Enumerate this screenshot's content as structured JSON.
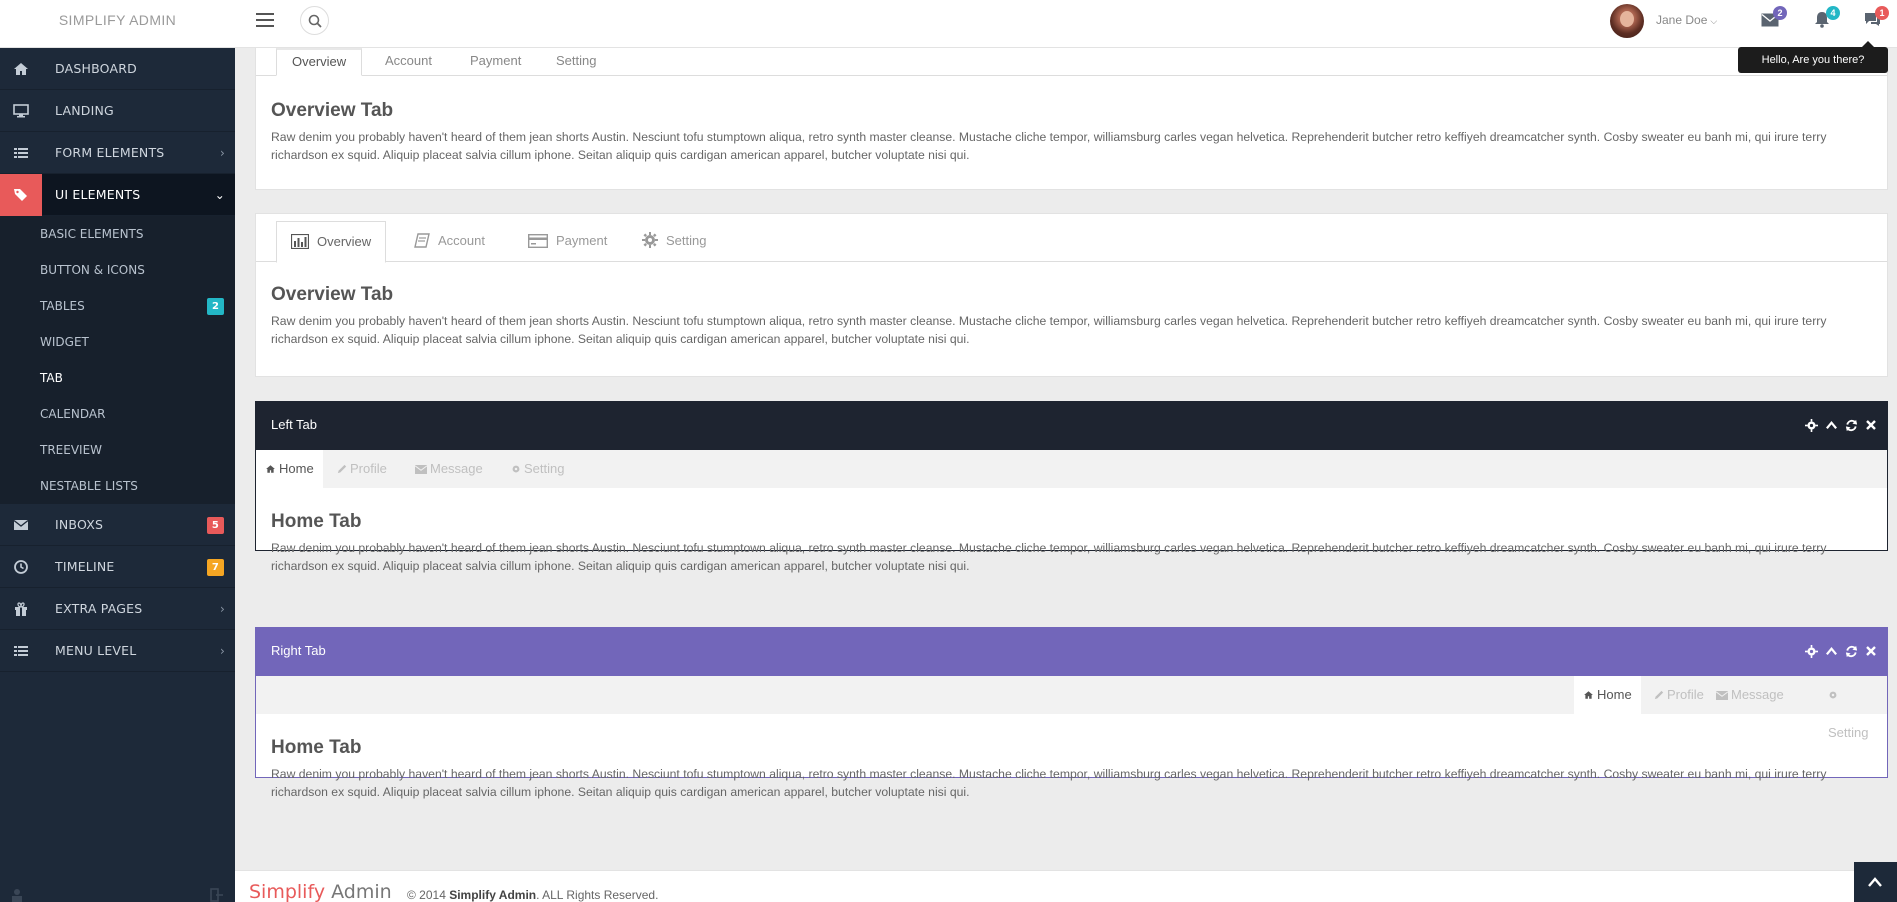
{
  "brand": "SIMPLIFY ADMIN",
  "user": {
    "name": "Jane Doe"
  },
  "notifications": {
    "mail_count": "2",
    "bell_count": "4",
    "chat_count": "1"
  },
  "tooltip": "Hello, Are you there?",
  "sidebar": {
    "items": [
      {
        "label": "DASHBOARD",
        "icon": "home-icon"
      },
      {
        "label": "LANDING",
        "icon": "monitor-icon"
      },
      {
        "label": "FORM ELEMENTS",
        "icon": "list-icon"
      },
      {
        "label": "UI ELEMENTS",
        "icon": "tags-icon"
      }
    ],
    "sub_items": [
      {
        "label": "BASIC ELEMENTS"
      },
      {
        "label": "BUTTON & ICONS"
      },
      {
        "label": "TABLES",
        "badge": "2"
      },
      {
        "label": "WIDGET"
      },
      {
        "label": "TAB"
      },
      {
        "label": "CALENDAR"
      },
      {
        "label": "TREEVIEW"
      },
      {
        "label": "NESTABLE LISTS"
      }
    ],
    "items2": [
      {
        "label": "INBOXS",
        "icon": "envelope-icon",
        "badge": "5"
      },
      {
        "label": "TIMELINE",
        "icon": "clock-icon",
        "badge": "7"
      },
      {
        "label": "EXTRA PAGES",
        "icon": "gift-icon"
      },
      {
        "label": "MENU LEVEL",
        "icon": "list-icon"
      }
    ]
  },
  "panel1": {
    "tabs": [
      "Overview",
      "Account",
      "Payment",
      "Setting"
    ],
    "title": "Overview Tab",
    "text": "Raw denim you probably haven't heard of them jean shorts Austin. Nesciunt tofu stumptown aliqua, retro synth master cleanse. Mustache cliche tempor, williamsburg carles vegan helvetica. Reprehenderit butcher retro keffiyeh dreamcatcher synth. Cosby sweater eu banh mi, qui irure terry richardson ex squid. Aliquip placeat salvia cillum iphone. Seitan aliquip quis cardigan american apparel, butcher voluptate nisi qui."
  },
  "panel2": {
    "tabs": [
      "Overview",
      "Account",
      "Payment",
      "Setting"
    ],
    "title": "Overview Tab",
    "text": "Raw denim you probably haven't heard of them jean shorts Austin. Nesciunt tofu stumptown aliqua, retro synth master cleanse. Mustache cliche tempor, williamsburg carles vegan helvetica. Reprehenderit butcher retro keffiyeh dreamcatcher synth. Cosby sweater eu banh mi, qui irure terry richardson ex squid. Aliquip placeat salvia cillum iphone. Seitan aliquip quis cardigan american apparel, butcher voluptate nisi qui."
  },
  "panel3": {
    "header": "Left Tab",
    "tabs": [
      "Home",
      "Profile",
      "Message",
      "Setting"
    ],
    "title": "Home Tab",
    "text": "Raw denim you probably haven't heard of them jean shorts Austin. Nesciunt tofu stumptown aliqua, retro synth master cleanse. Mustache cliche tempor, williamsburg carles vegan helvetica. Reprehenderit butcher retro keffiyeh dreamcatcher synth. Cosby sweater eu banh mi, qui irure terry richardson ex squid. Aliquip placeat salvia cillum iphone. Seitan aliquip quis cardigan american apparel, butcher voluptate nisi qui."
  },
  "panel4": {
    "header": "Right Tab",
    "tabs": [
      "Home",
      "Profile",
      "Message",
      "Setting"
    ],
    "title": "Home Tab",
    "text": "Raw denim you probably haven't heard of them jean shorts Austin. Nesciunt tofu stumptown aliqua, retro synth master cleanse. Mustache cliche tempor, williamsburg carles vegan helvetica. Reprehenderit butcher retro keffiyeh dreamcatcher synth. Cosby sweater eu banh mi, qui irure terry richardson ex squid. Aliquip placeat salvia cillum iphone. Seitan aliquip quis cardigan american apparel, butcher voluptate nisi qui."
  },
  "footer": {
    "logo_a": "Simplify",
    "logo_b": " Admin",
    "copy_a": "© 2014 ",
    "copy_b": "Simplify Admin",
    "copy_c": ". ALL Rights Reserved."
  },
  "colors": {
    "accent": "#e85a5a",
    "sidebar": "#1d2939",
    "dark_header": "#1e2430",
    "purple_header": "#7266ba",
    "badge_teal": "#23b7c6",
    "badge_red": "#e85a5a",
    "badge_orange": "#f5a623",
    "badge_purple": "#7266ba"
  }
}
